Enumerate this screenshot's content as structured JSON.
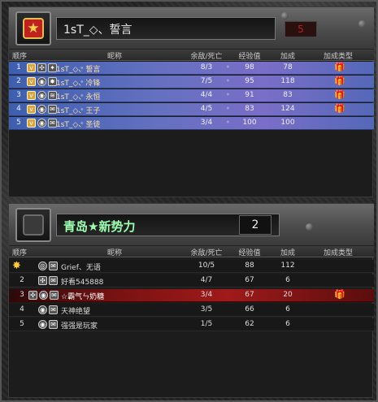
{
  "colors": {
    "team1_row_bg": "#5f6cc0",
    "highlight_row_bg": "#8a1414",
    "team1_name": "#e8e8e8",
    "team2_name": "#9dffb0",
    "team1_score": "#b52020"
  },
  "team1": {
    "name": "1sT_◇、誓言",
    "score": "5",
    "headers": [
      "顺序",
      "昵称",
      "余敌/死亡",
      "经验值",
      "加成",
      "加成类型"
    ],
    "rows": [
      {
        "order": "1",
        "name": "1sT_◇、誓言",
        "kd": "8/3",
        "exp": "98",
        "bonus": "78"
      },
      {
        "order": "2",
        "name": "1sT_◇、冷锋",
        "kd": "7/5",
        "exp": "95",
        "bonus": "118"
      },
      {
        "order": "3",
        "name": "1sT_◇、永恒",
        "kd": "4/4",
        "exp": "91",
        "bonus": "83"
      },
      {
        "order": "4",
        "name": "1sT_◇、王子",
        "kd": "4/5",
        "exp": "83",
        "bonus": "124"
      },
      {
        "order": "5",
        "name": "1sT_◇、圣徒",
        "kd": "3/4",
        "exp": "100",
        "bonus": "100"
      }
    ]
  },
  "team2": {
    "name": "青岛★新势力",
    "score": "2",
    "headers": [
      "顺序",
      "昵称",
      "余敌/死亡",
      "经验值",
      "加成",
      "加成类型"
    ],
    "rows": [
      {
        "order": "",
        "name": "Grief、无语",
        "kd": "10/5",
        "exp": "88",
        "bonus": "112"
      },
      {
        "order": "2",
        "name": "好看545888",
        "kd": "4/7",
        "exp": "67",
        "bonus": "6"
      },
      {
        "order": "3",
        "name": "☆霸气ㄣ奶糖",
        "kd": "3/4",
        "exp": "67",
        "bonus": "20"
      },
      {
        "order": "4",
        "name": "天神绝望",
        "kd": "3/5",
        "exp": "66",
        "bonus": "6"
      },
      {
        "order": "5",
        "name": "强强是玩家",
        "kd": "1/5",
        "exp": "62",
        "bonus": "6"
      }
    ]
  }
}
